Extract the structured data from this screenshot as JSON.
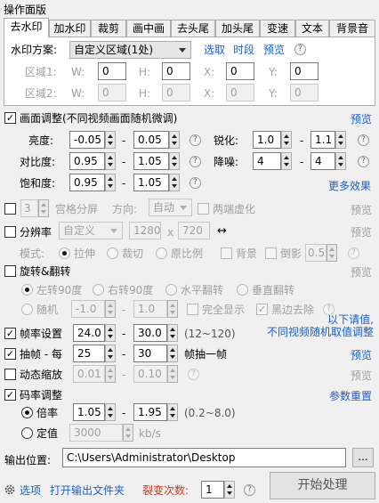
{
  "panel_title": "操作面版",
  "tabs": [
    "去水印",
    "加水印",
    "裁剪",
    "画中画",
    "去头尾",
    "加头尾",
    "变速",
    "文本",
    "背景音"
  ],
  "watermark": {
    "scheme_label": "水印方案:",
    "scheme_value": "自定义区域(1处)",
    "links": [
      "选取",
      "时段",
      "预览"
    ],
    "region1_label": "区域1:",
    "region2_label": "区域2:",
    "W": "W:",
    "H": "H:",
    "X": "X:",
    "Y": "Y:",
    "region1_values": [
      "0",
      "0",
      "0",
      "0"
    ],
    "region2_values": [
      "0",
      "0",
      "0",
      "0"
    ]
  },
  "picture": {
    "label": "画面调整(不同视频画面随机微调)",
    "preview": "预览",
    "brightness_label": "亮度:",
    "brightness": [
      "-0.05",
      "0.05"
    ],
    "contrast_label": "对比度:",
    "contrast": [
      "0.95",
      "1.05"
    ],
    "saturation_label": "饱和度:",
    "saturation": [
      "0.95",
      "1.05"
    ],
    "sharpen_label": "锐化:",
    "sharpen": [
      "1.0",
      "1.1"
    ],
    "denoise_label": "降噪:",
    "denoise": [
      "4",
      "4"
    ],
    "more_effects": "更多效果",
    "dash": "-"
  },
  "grid": {
    "count": "3",
    "label": "宫格分屏",
    "direction_label": "方向:",
    "direction_value": "自动",
    "blur_label": "两端虚化",
    "preview": "预览"
  },
  "resolution": {
    "label": "分辨率",
    "preset": "自定义",
    "width": "1280",
    "x": "x",
    "height": "720",
    "swap_icon": "↔",
    "preview": "预览",
    "mode_label": "模式:",
    "modes": [
      "拉伸",
      "裁切",
      "原比例"
    ],
    "background_label": "背景",
    "reflection_label": "倒影",
    "reflection_value": "0.5"
  },
  "rotate": {
    "label": "旋转&翻转",
    "preview": "预览",
    "options": [
      "左转90度",
      "右转90度",
      "水平翻转",
      "垂直翻转"
    ],
    "random_label": "随机",
    "random_min": "-1.0",
    "random_max": "1.0",
    "full_display": "完全显示",
    "remove_black": "黑边去除"
  },
  "note": {
    "line1": "以下请值,",
    "line2": "不同视频随机取值调整"
  },
  "framerate": {
    "label": "帧率设置",
    "min": "24.0",
    "max": "30.0",
    "range": "(12~120)"
  },
  "drop": {
    "label": "抽帧 - 每",
    "from": "25",
    "to": "30",
    "suffix": "帧抽一帧",
    "preview": "预览"
  },
  "zoom": {
    "label": "动态缩放",
    "min": "0.01",
    "max": "0.10",
    "preview": "预览"
  },
  "bitrate": {
    "label": "码率调整",
    "reset": "参数重置",
    "multiplier_label": "倍率",
    "mult_min": "1.05",
    "mult_max": "1.95",
    "mult_range": "(0.2~8.0)",
    "fixed_label": "定值",
    "fixed_value": "3000",
    "unit": "kb/s"
  },
  "output": {
    "label": "输出位置:",
    "path": "C:\\Users\\Administrator\\Desktop",
    "browse": "..."
  },
  "footer": {
    "options": "选项",
    "open_folder": "打开输出文件夹",
    "fission_label": "裂变次数:",
    "fission_value": "1",
    "start": "开始处理"
  }
}
